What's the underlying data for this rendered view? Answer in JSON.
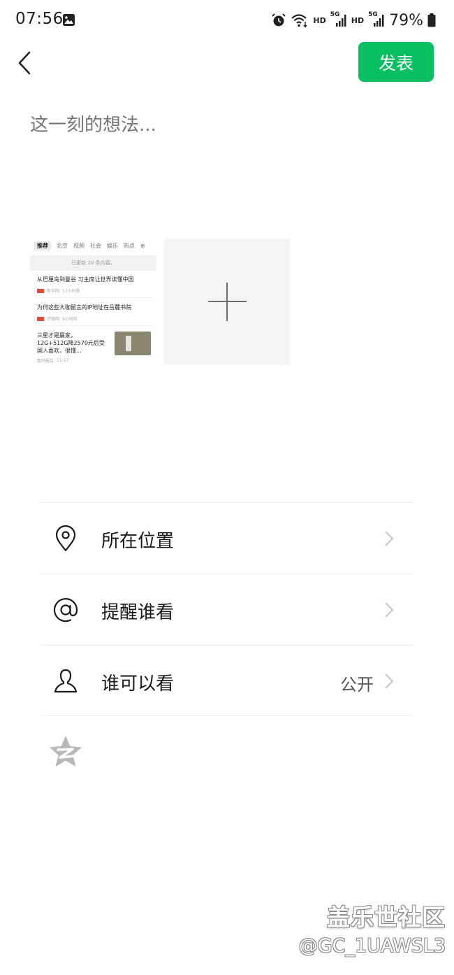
{
  "status_bar": {
    "time": "07:56",
    "hd1": "HD",
    "sig1": "5G",
    "hd2": "HD",
    "sig2": "5G",
    "battery": "79%",
    "icons": [
      "gallery-icon",
      "alarm-icon",
      "wifi-icon",
      "signal-icon",
      "battery-icon"
    ]
  },
  "header": {
    "back_icon": "chevron-left-icon",
    "post_label": "发表",
    "accent_color": "#07c160"
  },
  "composer": {
    "placeholder": "这一刻的想法..."
  },
  "thumbnail": {
    "tabs": [
      "推荐",
      "北京",
      "视频",
      "社会",
      "娱乐",
      "热点"
    ],
    "plus_icon": "⊕",
    "update_text": "已更新 20 条内容。",
    "items": [
      {
        "title": "从巴厘岛到曼谷 习主席让世界读懂中国",
        "source": "新华网",
        "time": "17小时前"
      },
      {
        "title": "为何这些大咖留言的IP地址在岳麓书院",
        "source": "环球网",
        "time": "9小时前"
      },
      {
        "title": "三星才是赢家，12G+512G降2570元后受国人喜欢，很懂...",
        "source": "数码报告",
        "time": "11-17"
      }
    ]
  },
  "add_photo": {
    "icon": "plus-icon"
  },
  "options": [
    {
      "label": "所在位置",
      "value": "",
      "icon": "location-pin-icon"
    },
    {
      "label": "提醒谁看",
      "value": "",
      "icon": "at-icon"
    },
    {
      "label": "谁可以看",
      "value": "公开",
      "icon": "person-icon"
    }
  ],
  "qzone": {
    "icon": "qzone-star-icon"
  },
  "watermark": {
    "title": "盖乐世社区",
    "user": "@GC_1UAWSL3"
  }
}
